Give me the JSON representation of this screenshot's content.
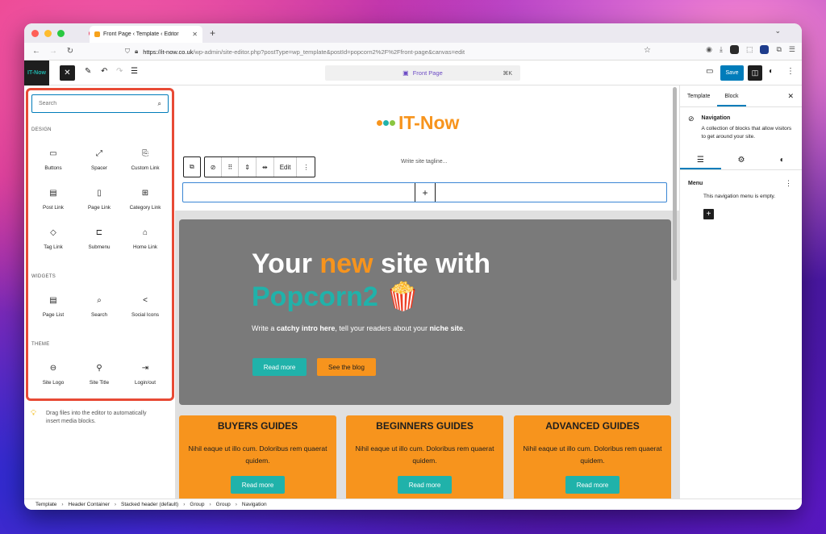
{
  "browser": {
    "tab_title": "Front Page ‹ Template ‹ Editor",
    "url_host": "https://it-now.co.uk",
    "url_path": "/wp-admin/site-editor.php?postType=wp_template&postId=popcorn2%2F%2Ffront-page&canvas=edit"
  },
  "toolbar": {
    "site_logo_text": "IT-Now",
    "command_title": "Front Page",
    "command_shortcut": "⌘K",
    "save_label": "Save"
  },
  "inserter": {
    "search_placeholder": "Search",
    "categories": [
      {
        "label": "DESIGN",
        "blocks": [
          {
            "label": "Buttons",
            "icon": "buttons-icon"
          },
          {
            "label": "Spacer",
            "icon": "spacer-icon"
          },
          {
            "label": "Custom Link",
            "icon": "custom-link-icon"
          },
          {
            "label": "Post Link",
            "icon": "post-link-icon"
          },
          {
            "label": "Page Link",
            "icon": "page-link-icon"
          },
          {
            "label": "Category Link",
            "icon": "category-link-icon"
          },
          {
            "label": "Tag Link",
            "icon": "tag-link-icon"
          },
          {
            "label": "Submenu",
            "icon": "submenu-icon"
          },
          {
            "label": "Home Link",
            "icon": "home-link-icon"
          }
        ]
      },
      {
        "label": "WIDGETS",
        "blocks": [
          {
            "label": "Page List",
            "icon": "page-list-icon"
          },
          {
            "label": "Search",
            "icon": "search-icon"
          },
          {
            "label": "Social Icons",
            "icon": "share-icon"
          }
        ]
      },
      {
        "label": "THEME",
        "blocks": [
          {
            "label": "Site Logo",
            "icon": "site-logo-icon"
          },
          {
            "label": "Site Title",
            "icon": "map-pin-icon"
          },
          {
            "label": "Login/out",
            "icon": "login-icon"
          }
        ]
      }
    ],
    "drag_hint": "Drag files into the editor to automatically insert media blocks."
  },
  "canvas": {
    "brand_name": "IT-Now",
    "tagline_placeholder": "Write site tagline...",
    "block_toolbar_edit": "Edit",
    "hero": {
      "line1_a": "Your ",
      "line1_b": "new",
      "line1_c": " site with",
      "line2": "Popcorn2 🍿",
      "intro_a": "Write a ",
      "intro_b": "catchy intro here",
      "intro_c": ", tell your readers about your ",
      "intro_d": "niche site",
      "intro_e": ".",
      "btn_read_more": "Read more",
      "btn_see_blog": "See the blog"
    },
    "cards": [
      {
        "title": "BUYERS GUIDES",
        "text": "Nihil eaque ut illo cum. Doloribus rem quaerat quidem.",
        "button": "Read more"
      },
      {
        "title": "BEGINNERS GUIDES",
        "text": "Nihil eaque ut illo cum. Doloribus rem quaerat quidem.",
        "button": "Read more"
      },
      {
        "title": "ADVANCED GUIDES",
        "text": "Nihil eaque ut illo cum. Doloribus rem quaerat quidem.",
        "button": "Read more"
      }
    ]
  },
  "settings": {
    "tab_template": "Template",
    "tab_block": "Block",
    "block_name": "Navigation",
    "block_desc": "A collection of blocks that allow visitors to get around your site.",
    "menu_label": "Menu",
    "menu_empty": "This navigation menu is empty."
  },
  "breadcrumbs": [
    "Template",
    "Header Container",
    "Stacked header (default)",
    "Group",
    "Group",
    "Navigation"
  ],
  "colors": {
    "accent_blue": "#007cba",
    "brand_orange": "#f7941d",
    "brand_teal": "#20b2aa",
    "highlight_red": "#e84a35"
  }
}
